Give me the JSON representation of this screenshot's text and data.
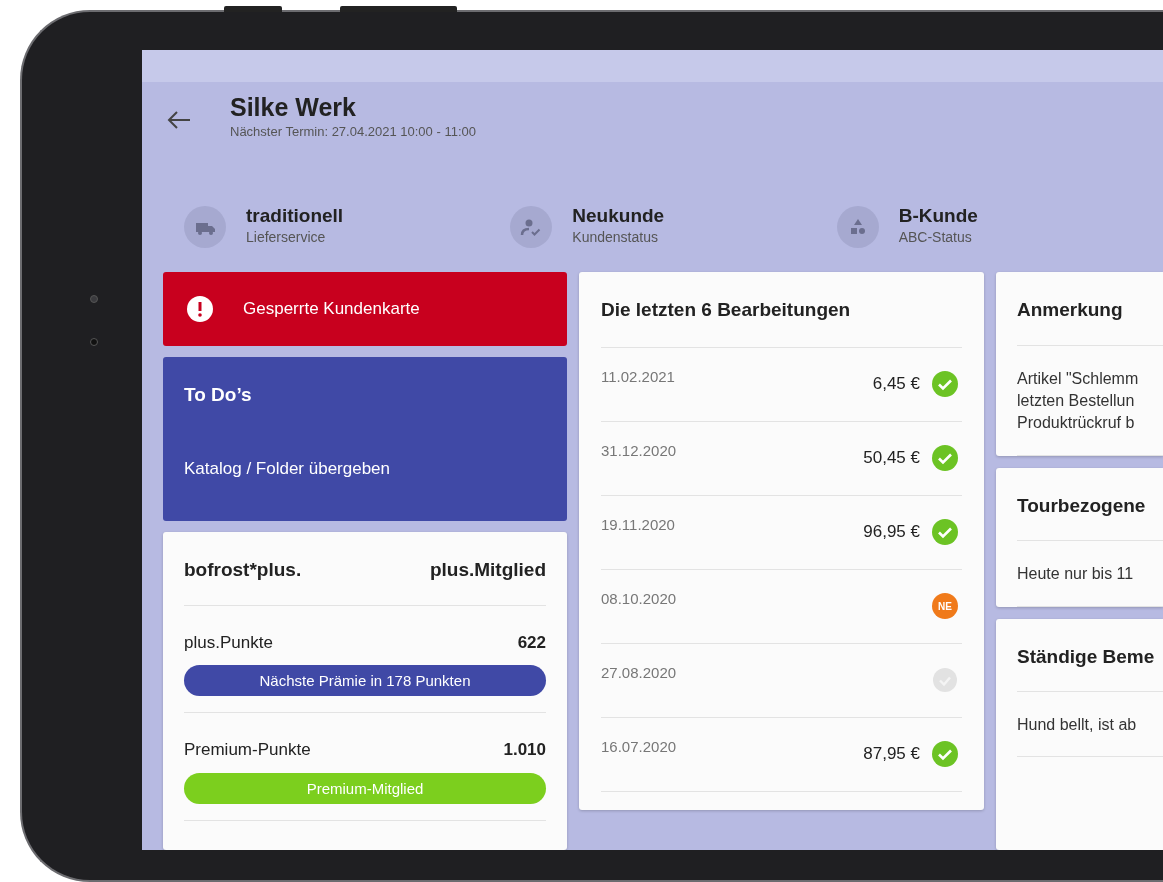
{
  "header": {
    "title": "Silke Werk",
    "subtitle": "Nächster Termin: 27.04.2021 10:00 - 11:00"
  },
  "status_items": [
    {
      "kind": "truck",
      "value": "traditionell",
      "label": "Lieferservice"
    },
    {
      "kind": "person",
      "value": "Neukunde",
      "label": "Kundenstatus"
    },
    {
      "kind": "shapes",
      "value": "B-Kunde",
      "label": "ABC-Status"
    }
  ],
  "alert": {
    "text": "Gesperrte Kundenkarte"
  },
  "todo": {
    "title": "To Do’s",
    "items": [
      "Katalog / Folder übergeben"
    ]
  },
  "loyalty": {
    "title": "bofrost*plus.",
    "status": "plus.Mitglied",
    "rows": [
      {
        "label": "plus.Punkte",
        "value": "622",
        "pill": "Nächste Prämie in 178 Punkten",
        "color": "#4049a6"
      },
      {
        "label": "Premium-Punkte",
        "value": "1.010",
        "pill": "Premium-Mitglied",
        "color": "#7ccf1e"
      }
    ]
  },
  "history": {
    "title": "Die letzten 6 Bearbeitungen",
    "rows": [
      {
        "date": "11.02.2021",
        "amount": "6,45 €",
        "kind": "done"
      },
      {
        "date": "31.12.2020",
        "amount": "50,45 €",
        "kind": "done"
      },
      {
        "date": "19.11.2020",
        "amount": "96,95 €",
        "kind": "done"
      },
      {
        "date": "08.10.2020",
        "kind": "ne",
        "badge": "NE"
      },
      {
        "date": "27.08.2020",
        "kind": "inactive"
      },
      {
        "date": "16.07.2020",
        "amount": "87,95 €",
        "kind": "done"
      }
    ]
  },
  "notes": [
    {
      "title": "Anmerkung",
      "text": "Artikel \"Schlemm\nletzten Bestellun\nProduktrückruf b"
    },
    {
      "title": "Tourbezogene",
      "text": "Heute nur bis 11"
    },
    {
      "title": "Ständige Beme",
      "text": "Hund bellt, ist ab"
    }
  ]
}
